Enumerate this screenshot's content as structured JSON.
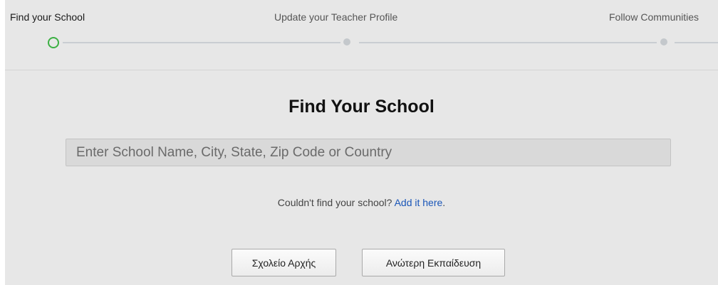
{
  "stepper": {
    "steps": [
      {
        "label": "Find your School",
        "state": "active"
      },
      {
        "label": "Update your Teacher Profile",
        "state": "pending"
      },
      {
        "label": "Follow Communities",
        "state": "pending"
      }
    ],
    "colors": {
      "active": "#3cb043",
      "pending": "#c4c8cc"
    }
  },
  "main": {
    "title": "Find Your School",
    "search": {
      "placeholder": "Enter School Name, City, State, Zip Code or Country",
      "value": ""
    },
    "hint": {
      "text": "Couldn't find your school? ",
      "link": "Add it here",
      "suffix": "."
    },
    "buttons": {
      "primary_school": "Σχολείο Αρχής",
      "higher_education": "Ανώτερη Εκπαίδευση"
    },
    "link_color": "#1a56b8"
  }
}
